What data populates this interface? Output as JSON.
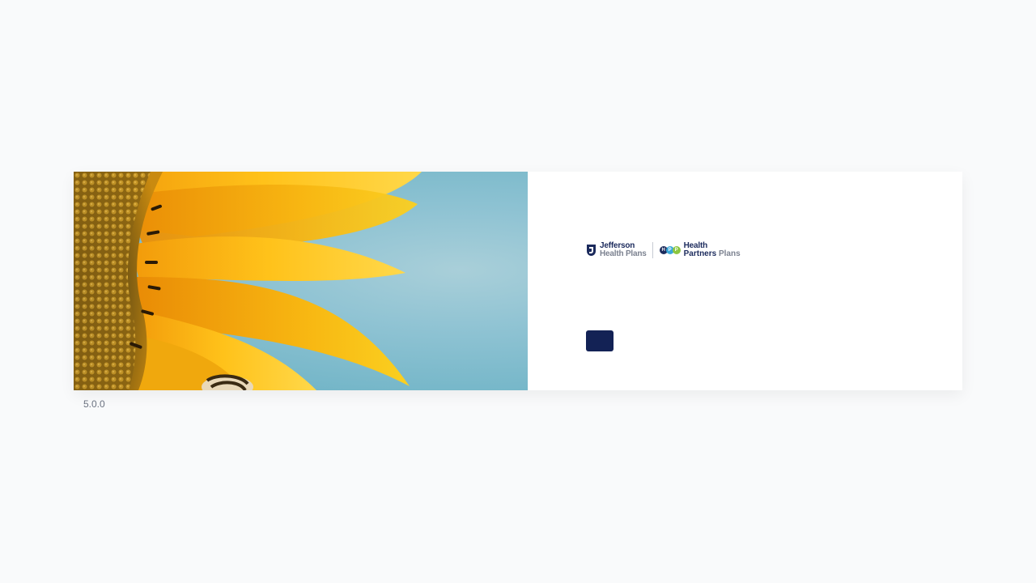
{
  "brand": {
    "jefferson_line1": "Jefferson",
    "jefferson_line2": "Health Plans",
    "hpp_line1": "Health",
    "hpp_line2_a": "Partners",
    "hpp_line2_b": "Plans",
    "hpp_dot_letters": [
      "H",
      "P",
      "P"
    ],
    "colors": {
      "navy": "#1b2a5c",
      "gray": "#7c8290",
      "blue": "#3aa7d8",
      "green": "#8cc63f"
    }
  },
  "login_button": {
    "label": "",
    "color": "#132255"
  },
  "hero_image": {
    "subject": "sunflower-with-bee"
  },
  "footer": {
    "version": "5.0.0"
  }
}
